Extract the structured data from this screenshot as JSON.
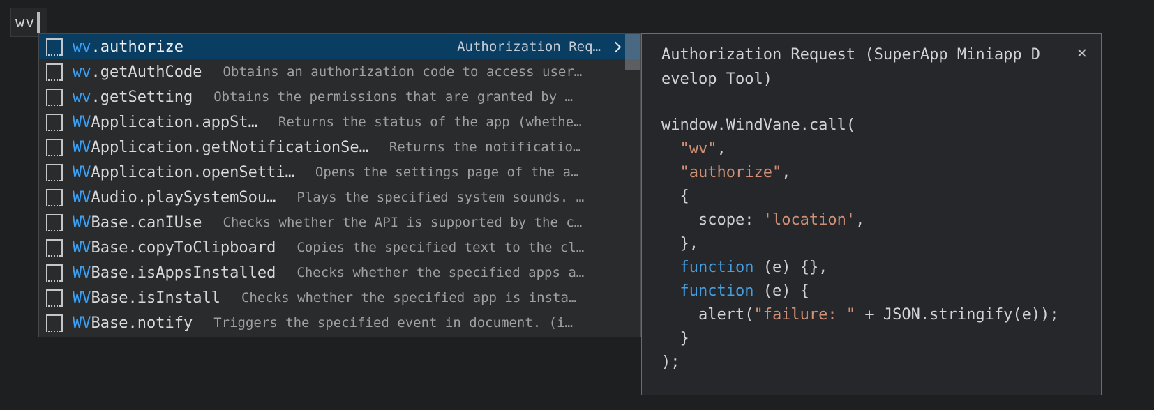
{
  "colors": {
    "match_blue": "#3ba2f7",
    "selection_bg": "#0a3d62",
    "string_salmon": "#d18f76",
    "keyword_blue": "#479fe0"
  },
  "editor": {
    "typed_text": "wv"
  },
  "suggest": {
    "items": [
      {
        "match": "wv",
        "rest": ".authorize",
        "detail": "Authorization Req…",
        "selected": true,
        "expandable": true
      },
      {
        "match": "wv",
        "rest": ".getAuthCode",
        "detail": "Obtains an authorization code to access user…"
      },
      {
        "match": "wv",
        "rest": ".getSetting",
        "detail": "Obtains the permissions that are granted by …"
      },
      {
        "match": "WV",
        "rest": "Application.appSt…",
        "detail": "Returns the status of the app (whethe…"
      },
      {
        "match": "WV",
        "rest": "Application.getNotificationSe…",
        "detail": "Returns the notificatio…"
      },
      {
        "match": "WV",
        "rest": "Application.openSetti…",
        "detail": "Opens the settings page of the a…"
      },
      {
        "match": "WV",
        "rest": "Audio.playSystemSou…",
        "detail": "Plays the specified system sounds. …"
      },
      {
        "match": "WV",
        "rest": "Base.canIUse",
        "detail": "Checks whether the API is supported by the c…"
      },
      {
        "match": "WV",
        "rest": "Base.copyToClipboard",
        "detail": "Copies the specified text to the cl…"
      },
      {
        "match": "WV",
        "rest": "Base.isAppsInstalled",
        "detail": "Checks whether the specified apps a…"
      },
      {
        "match": "WV",
        "rest": "Base.isInstall",
        "detail": "Checks whether the specified app is insta…"
      },
      {
        "match": "WV",
        "rest": "Base.notify",
        "detail": "Triggers the specified event in document. (i…"
      }
    ]
  },
  "docs": {
    "title": "Authorization Request (SuperApp Miniapp Develop Tool)",
    "close_icon": "✕",
    "code": [
      [
        {
          "t": "window.WindVane.call(",
          "c": "p"
        }
      ],
      [
        {
          "t": "  ",
          "c": "p"
        },
        {
          "t": "\"wv\"",
          "c": "s"
        },
        {
          "t": ",",
          "c": "p"
        }
      ],
      [
        {
          "t": "  ",
          "c": "p"
        },
        {
          "t": "\"authorize\"",
          "c": "s"
        },
        {
          "t": ",",
          "c": "p"
        }
      ],
      [
        {
          "t": "  {",
          "c": "p"
        }
      ],
      [
        {
          "t": "    scope: ",
          "c": "p"
        },
        {
          "t": "'location'",
          "c": "s"
        },
        {
          "t": ",",
          "c": "p"
        }
      ],
      [
        {
          "t": "  },",
          "c": "p"
        }
      ],
      [
        {
          "t": "  ",
          "c": "p"
        },
        {
          "t": "function",
          "c": "k"
        },
        {
          "t": " (e) {},",
          "c": "p"
        }
      ],
      [
        {
          "t": "  ",
          "c": "p"
        },
        {
          "t": "function",
          "c": "k"
        },
        {
          "t": " (e) {",
          "c": "p"
        }
      ],
      [
        {
          "t": "    alert(",
          "c": "p"
        },
        {
          "t": "\"failure: \"",
          "c": "s"
        },
        {
          "t": " + JSON.stringify(e));",
          "c": "p"
        }
      ],
      [
        {
          "t": "  }",
          "c": "p"
        }
      ],
      [
        {
          "t": ");",
          "c": "p"
        }
      ]
    ]
  }
}
